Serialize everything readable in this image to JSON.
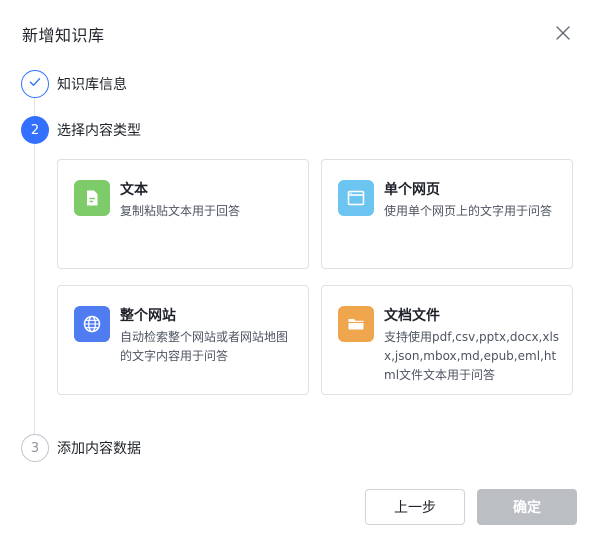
{
  "dialog": {
    "title": "新增知识库",
    "close_icon": "close-icon"
  },
  "steps": [
    {
      "number": "1",
      "label": "知识库信息",
      "status": "done",
      "icon": "check-icon"
    },
    {
      "number": "2",
      "label": "选择内容类型",
      "status": "active"
    },
    {
      "number": "3",
      "label": "添加内容数据",
      "status": "pending"
    }
  ],
  "content_types": [
    {
      "title": "文本",
      "desc": "复制粘贴文本用于回答",
      "icon": "document-icon",
      "color": "#7ecb6a"
    },
    {
      "title": "单个网页",
      "desc": "使用单个网页上的文字用于问答",
      "icon": "webpage-icon",
      "color": "#6cc4f0"
    },
    {
      "title": "整个网站",
      "desc": "自动检索整个网站或者网站地图的文字内容用于问答",
      "icon": "globe-icon",
      "color": "#4f7cf0"
    },
    {
      "title": "文档文件",
      "desc": "支持使用pdf,csv,pptx,docx,xlsx,json,mbox,md,epub,eml,html文件文本用于问答",
      "icon": "folder-icon",
      "color": "#f0a64c"
    }
  ],
  "footer": {
    "prev_label": "上一步",
    "confirm_label": "确定"
  },
  "colors": {
    "primary": "#3370ff",
    "disabled_button": "#bbbfc4"
  }
}
